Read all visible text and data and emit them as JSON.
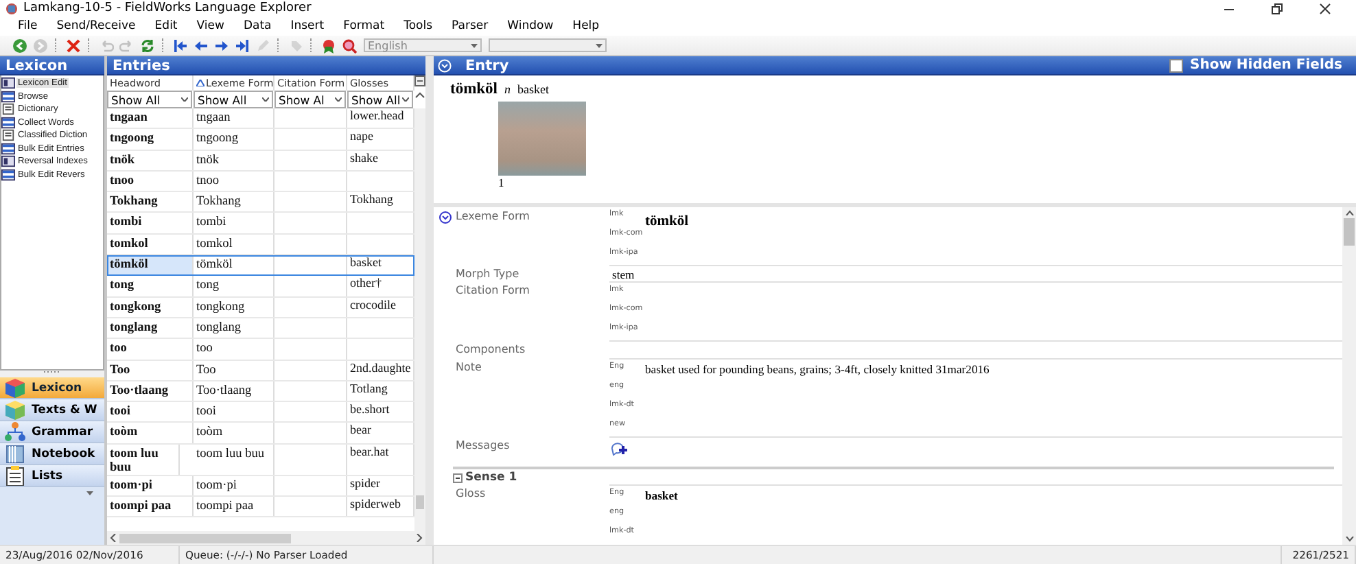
{
  "window": {
    "title": "Lamkang-10-5 - FieldWorks Language Explorer"
  },
  "menu": [
    "File",
    "Send/Receive",
    "Edit",
    "View",
    "Data",
    "Insert",
    "Format",
    "Tools",
    "Parser",
    "Window",
    "Help"
  ],
  "toolbar": {
    "buttons": [
      {
        "kind": "back",
        "disabled": false
      },
      {
        "kind": "forward",
        "disabled": true
      },
      {
        "kind": "sep"
      },
      {
        "kind": "delete",
        "disabled": false
      },
      {
        "kind": "sep"
      },
      {
        "kind": "undo",
        "disabled": true
      },
      {
        "kind": "redo",
        "disabled": true
      },
      {
        "kind": "refresh",
        "disabled": false
      },
      {
        "kind": "sep"
      },
      {
        "kind": "first",
        "disabled": false
      },
      {
        "kind": "previous",
        "disabled": false
      },
      {
        "kind": "next",
        "disabled": false
      },
      {
        "kind": "last",
        "disabled": false
      },
      {
        "kind": "pencil",
        "disabled": true
      },
      {
        "kind": "sep"
      },
      {
        "kind": "tag",
        "disabled": true
      },
      {
        "kind": "sep"
      },
      {
        "kind": "bookmark",
        "disabled": false
      },
      {
        "kind": "find",
        "disabled": false
      }
    ],
    "combos": [
      {
        "value": "English"
      }
    ]
  },
  "sidebar": {
    "title": "Lexicon",
    "tools": [
      {
        "label": "Lexicon Edit",
        "kind": "edit",
        "selected": true
      },
      {
        "label": "Browse",
        "kind": "browse",
        "selected": false
      },
      {
        "label": "Dictionary",
        "kind": "doc",
        "selected": false
      },
      {
        "label": "Collect Words",
        "kind": "browse",
        "selected": false
      },
      {
        "label": "Classified Diction",
        "kind": "doc",
        "selected": false
      },
      {
        "label": "Bulk Edit Entries",
        "kind": "browse",
        "selected": false
      },
      {
        "label": "Reversal Indexes",
        "kind": "edit",
        "selected": false
      },
      {
        "label": "Bulk Edit Revers",
        "kind": "browse",
        "selected": false
      }
    ],
    "areas": [
      {
        "label": "Lexicon",
        "kind": "cube",
        "selected": true
      },
      {
        "label": "Texts & W",
        "kind": "box",
        "selected": false
      },
      {
        "label": "Grammar",
        "kind": "tree",
        "selected": false
      },
      {
        "label": "Notebook",
        "kind": "notebook",
        "selected": false
      },
      {
        "label": "Lists",
        "kind": "list",
        "selected": false
      }
    ]
  },
  "entries": {
    "title": "Entries",
    "columns": [
      {
        "label": "Headword",
        "sorted": false
      },
      {
        "label": "Lexeme Form",
        "sorted": true
      },
      {
        "label": "Citation Form",
        "sorted": false
      },
      {
        "label": "Glosses",
        "sorted": false
      }
    ],
    "filters": [
      "Show All",
      "Show All",
      "Show Al",
      "Show All"
    ],
    "rows": [
      {
        "headword": "tngaan",
        "lexeme": "tngaan",
        "gloss": "lower.head",
        "selected": false
      },
      {
        "headword": "tngoong",
        "lexeme": "tngoong",
        "gloss": "nape",
        "selected": false
      },
      {
        "headword": "tnök",
        "lexeme": "tnök",
        "gloss": "shake",
        "selected": false
      },
      {
        "headword": "tnoo",
        "lexeme": "tnoo",
        "selected": false
      },
      {
        "headword": "Tokhang",
        "lexeme": "Tokhang",
        "gloss": "Tokhang",
        "selected": false
      },
      {
        "headword": "tombi",
        "lexeme": "tombi",
        "selected": false
      },
      {
        "headword": "tomkol",
        "lexeme": "tomkol",
        "selected": false
      },
      {
        "headword": "tömköl",
        "lexeme": "tömköl",
        "gloss": "basket",
        "selected": true
      },
      {
        "headword": "tong",
        "lexeme": "tong",
        "gloss": "other†",
        "selected": false
      },
      {
        "headword": "tongkong",
        "lexeme": "tongkong",
        "gloss": "crocodile",
        "selected": false
      },
      {
        "headword": "tonglang",
        "lexeme": "tonglang",
        "selected": false
      },
      {
        "headword": "too",
        "lexeme": "too",
        "selected": false
      },
      {
        "headword": "Too",
        "lexeme": "Too",
        "gloss": "2nd.daughte",
        "selected": false
      },
      {
        "headword": "Too·tlaang",
        "lexeme": "Too·tlaang",
        "gloss": "Totlang",
        "selected": false
      },
      {
        "headword": "tooi",
        "lexeme": "tooi",
        "gloss": "be.short",
        "selected": false
      },
      {
        "headword": "toòm",
        "lexeme": "toòm",
        "gloss": "bear",
        "selected": false
      },
      {
        "headword": "toom luu buu",
        "lexeme": "toom luu buu",
        "gloss": "bear.hat",
        "selected": false
      },
      {
        "headword": "toom·pi",
        "lexeme": "toom·pi",
        "gloss": "spider",
        "selected": false
      },
      {
        "headword": "toompi paa",
        "lexeme": "toompi paa",
        "gloss": "spiderweb",
        "selected": false
      }
    ]
  },
  "entry": {
    "title": "Entry",
    "show_hidden_fields": {
      "label": "Show Hidden Fields",
      "checked": false
    },
    "summary": {
      "headword": "tömköl",
      "pos": "n",
      "gloss": "basket",
      "picture_caption": "1"
    },
    "fields": [
      {
        "kind": "multi",
        "label": "Lexeme Form",
        "collapsible": true,
        "ws": [
          {
            "code": "lmk",
            "value": "tömköl"
          },
          {
            "code": "lmk-com"
          },
          {
            "code": "lmk-ipa"
          }
        ]
      },
      {
        "kind": "single",
        "label": "Morph Type",
        "value": "stem"
      },
      {
        "kind": "multi",
        "label": "Citation Form",
        "ws": [
          {
            "code": "lmk"
          },
          {
            "code": "lmk-com"
          },
          {
            "code": "lmk-ipa"
          }
        ]
      },
      {
        "kind": "single",
        "label": "Components"
      },
      {
        "kind": "multi",
        "label": "Note",
        "ws": [
          {
            "code": "Eng",
            "value": "basket used for pounding beans, grains; 3-4ft, closely knitted 31mar2016"
          },
          {
            "code": "eng"
          },
          {
            "code": "lmk-dt"
          },
          {
            "code": "new"
          }
        ]
      },
      {
        "kind": "messages",
        "label": "Messages"
      },
      {
        "kind": "section",
        "label": "Sense 1"
      },
      {
        "kind": "multi",
        "label": "Gloss",
        "ws": [
          {
            "code": "Eng",
            "value": "basket",
            "bold": true
          },
          {
            "code": "eng"
          },
          {
            "code": "lmk-dt"
          }
        ]
      }
    ]
  },
  "status_bar": {
    "dates": "23/Aug/2016 02/Nov/2016",
    "parser": "Queue: (-/-/-) No Parser Loaded",
    "position": "2261/2521"
  }
}
